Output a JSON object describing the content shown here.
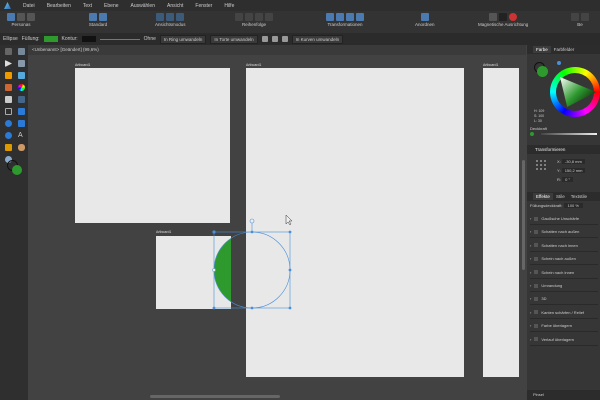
{
  "menu": [
    "Datei",
    "Bearbeiten",
    "Text",
    "Ebene",
    "Auswählen",
    "Ansicht",
    "Fenster",
    "Hilfe"
  ],
  "toolbar": {
    "groups": [
      "Personas",
      "Standard",
      "Ansichtsmodus",
      "Reihenfolge",
      "Transformationen",
      "Anordnen",
      "Magnetische Ausrichtung",
      "Be"
    ]
  },
  "context": {
    "shape": "Ellipse",
    "fill_label": "Füllung:",
    "fill_color": "#2e9a2e",
    "stroke_label": "Kontur:",
    "stroke_color": "#111111",
    "stroke_value": "Ohne",
    "btn_ring": "In Ring umwandeln",
    "btn_torte": "In Torte umwandeln",
    "btn_kurven": "In Kurven umwandeln"
  },
  "document": {
    "tab": "<Unbenannt> [Geändert] (99,6%)"
  },
  "artboards": [
    "Artboard1",
    "Artboard1",
    "Artboard1",
    "Artboard1"
  ],
  "panel": {
    "color_tabs": [
      "Farbe",
      "Farbfelder"
    ],
    "hsl": [
      "H: 109",
      "S: 100",
      "L: 30"
    ],
    "opacity_label": "Deckkraft",
    "transform_title": "Transformieren",
    "x_label": "X:",
    "x_value": "-30,8 mm",
    "y_label": "Y:",
    "y_value": "150,2 mm",
    "r_label": "R:",
    "r_value": "0 °",
    "effects_tabs": [
      "Effekte",
      "Stile",
      "Textstile"
    ],
    "fill_opacity_label": "Füllungsdeckkraft:",
    "fill_opacity_value": "100 %",
    "effects": [
      "Gaußsche Unschärfe",
      "Schatten nach außen",
      "Schatten nach innen",
      "Schein nach außen",
      "Schein nach innen",
      "Umrandung",
      "3D",
      "Kanten schärfen / Relief",
      "Farbe überlagern",
      "Verlauf überlagern"
    ],
    "bottom": "Pinsel"
  },
  "colors": {
    "accent": "#4a8fd8",
    "green": "#2e9a2e"
  }
}
